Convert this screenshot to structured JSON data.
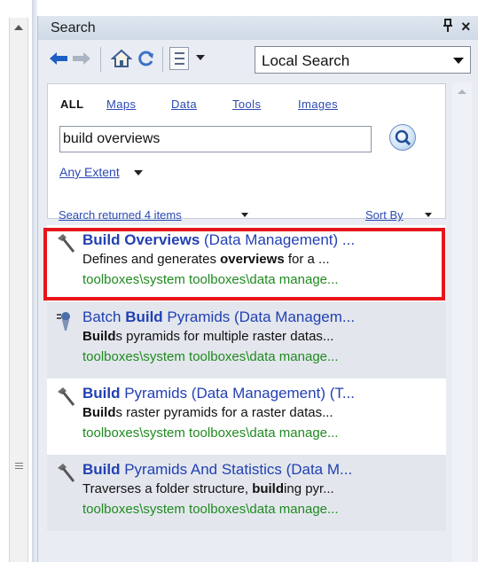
{
  "panel": {
    "title": "Search",
    "pin_glyph": "Ԅ",
    "close_glyph": "×"
  },
  "toolbar": {
    "back_icon": "back-arrow-icon",
    "forward_icon": "forward-arrow-icon",
    "home_icon": "home-icon",
    "refresh_icon": "refresh-icon",
    "view_icon": "list-view-icon",
    "scope_value": "Local Search"
  },
  "search": {
    "tabs": [
      {
        "label": "ALL",
        "active": true
      },
      {
        "label": "Maps",
        "active": false
      },
      {
        "label": "Data",
        "active": false
      },
      {
        "label": "Tools",
        "active": false
      },
      {
        "label": "Images",
        "active": false
      }
    ],
    "query": "build overviews",
    "extent": "Any Extent"
  },
  "results_bar": {
    "count_text": "Search returned 4 items",
    "sort_label": "Sort By"
  },
  "results": [
    {
      "icon": "hammer-tool-icon",
      "title_bold": "Build Overviews",
      "title_rest": " (Data Management) ...",
      "desc_pre": "Defines and generates ",
      "desc_bold": "overviews",
      "desc_post": " for a ...",
      "path": "toolboxes\\system toolboxes\\data manage...",
      "highlighted": true
    },
    {
      "icon": "batch-tool-icon",
      "title_pre": "Batch ",
      "title_bold": "Build",
      "title_rest": " Pyramids (Data Managem...",
      "desc_pre": "",
      "desc_bold": "Build",
      "desc_post": "s pyramids for multiple raster datas...",
      "path": "toolboxes\\system toolboxes\\data manage...",
      "highlighted": false
    },
    {
      "icon": "hammer-tool-icon",
      "title_bold": "Build",
      "title_rest": " Pyramids (Data Management) (T...",
      "desc_pre": "",
      "desc_bold": "Build",
      "desc_post": "s raster pyramids for a raster datas...",
      "path": "toolboxes\\system toolboxes\\data manage...",
      "highlighted": false
    },
    {
      "icon": "hammer-tool-icon",
      "title_bold": "Build",
      "title_rest": " Pyramids And Statistics (Data M...",
      "desc_pre": "Traverses a folder structure, ",
      "desc_bold": "build",
      "desc_post": "ing pyr...",
      "path": "toolboxes\\system toolboxes\\data manage...",
      "highlighted": false
    }
  ],
  "colors": {
    "link": "#2c4ab4",
    "title_link": "#2240b4",
    "path": "#1f8a1f",
    "highlight_box": "#e8151b"
  }
}
